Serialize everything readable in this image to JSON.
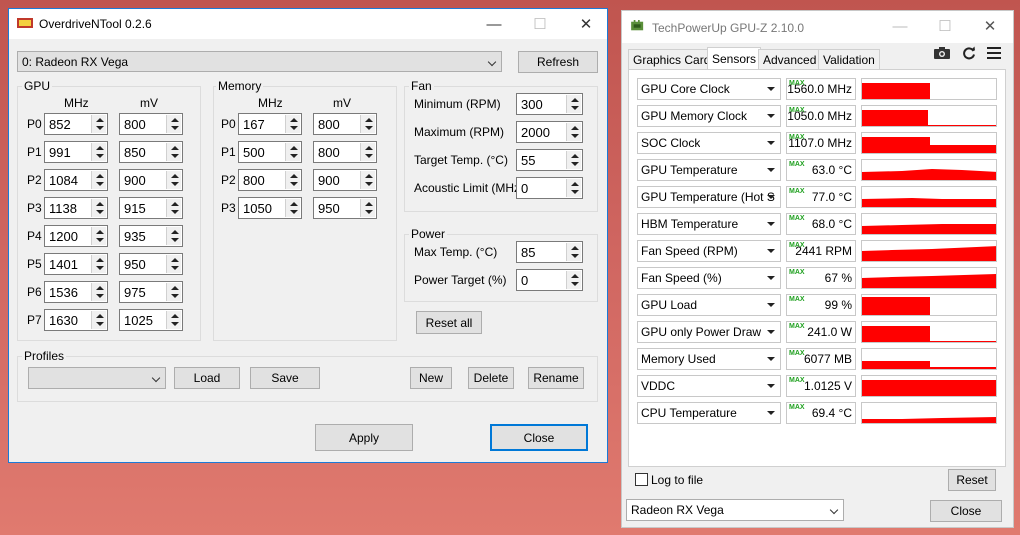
{
  "odnt": {
    "title": "OverdriveNTool 0.2.6",
    "gpu_select": "0: Radeon RX Vega",
    "refresh_label": "Refresh",
    "gpu_group": {
      "label": "GPU",
      "mhz_header": "MHz",
      "mv_header": "mV",
      "rows": [
        {
          "p": "P0",
          "mhz": "852",
          "mv": "800"
        },
        {
          "p": "P1",
          "mhz": "991",
          "mv": "850"
        },
        {
          "p": "P2",
          "mhz": "1084",
          "mv": "900"
        },
        {
          "p": "P3",
          "mhz": "1138",
          "mv": "915"
        },
        {
          "p": "P4",
          "mhz": "1200",
          "mv": "935"
        },
        {
          "p": "P5",
          "mhz": "1401",
          "mv": "950"
        },
        {
          "p": "P6",
          "mhz": "1536",
          "mv": "975"
        },
        {
          "p": "P7",
          "mhz": "1630",
          "mv": "1025"
        }
      ]
    },
    "memory_group": {
      "label": "Memory",
      "mhz_header": "MHz",
      "mv_header": "mV",
      "rows": [
        {
          "p": "P0",
          "mhz": "167",
          "mv": "800"
        },
        {
          "p": "P1",
          "mhz": "500",
          "mv": "800"
        },
        {
          "p": "P2",
          "mhz": "800",
          "mv": "900"
        },
        {
          "p": "P3",
          "mhz": "1050",
          "mv": "950"
        }
      ]
    },
    "fan_group": {
      "label": "Fan",
      "rows": [
        {
          "label": "Minimum (RPM)",
          "value": "300"
        },
        {
          "label": "Maximum (RPM)",
          "value": "2000"
        },
        {
          "label": "Target Temp. (°C)",
          "value": "55"
        },
        {
          "label": "Acoustic Limit (MHz)",
          "value": "0"
        }
      ]
    },
    "power_group": {
      "label": "Power",
      "rows": [
        {
          "label": "Max Temp. (°C)",
          "value": "85"
        },
        {
          "label": "Power Target (%)",
          "value": "0"
        }
      ]
    },
    "reset_all_label": "Reset all",
    "profiles": {
      "label": "Profiles",
      "selected": "",
      "load_label": "Load",
      "save_label": "Save",
      "new_label": "New",
      "delete_label": "Delete",
      "rename_label": "Rename"
    },
    "apply_label": "Apply",
    "close_label": "Close"
  },
  "gpuz": {
    "title": "TechPowerUp GPU-Z 2.10.0",
    "tabs": [
      "Graphics Card",
      "Sensors",
      "Advanced",
      "Validation"
    ],
    "active_tab": "Sensors",
    "max_tag": "MAX",
    "sensors": [
      {
        "name": "GPU Core Clock",
        "value": "1560.0 MHz"
      },
      {
        "name": "GPU Memory Clock",
        "value": "1050.0 MHz"
      },
      {
        "name": "SOC Clock",
        "value": "1107.0 MHz"
      },
      {
        "name": "GPU Temperature",
        "value": "63.0 °C"
      },
      {
        "name": "GPU Temperature (Hot Spot)",
        "value": "77.0 °C"
      },
      {
        "name": "HBM Temperature",
        "value": "68.0 °C"
      },
      {
        "name": "Fan Speed (RPM)",
        "value": "2441 RPM"
      },
      {
        "name": "Fan Speed (%)",
        "value": "67 %"
      },
      {
        "name": "GPU Load",
        "value": "99 %"
      },
      {
        "name": "GPU only Power Draw",
        "value": "241.0 W"
      },
      {
        "name": "Memory Used",
        "value": "6077 MB"
      },
      {
        "name": "VDDC",
        "value": "1.0125 V"
      },
      {
        "name": "CPU Temperature",
        "value": "69.4 °C"
      }
    ],
    "log_to_file_label": "Log to file",
    "reset_label": "Reset",
    "card_select": "Radeon RX Vega",
    "close_label": "Close",
    "graph_color": "#ff0000"
  }
}
